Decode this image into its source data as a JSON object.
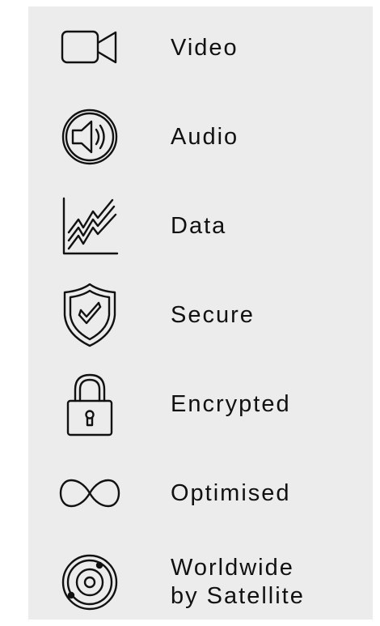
{
  "colors": {
    "panel_bg": "#ececec",
    "page_bg": "#ffffff",
    "ink": "#111111"
  },
  "features": [
    {
      "icon": "video-camera-icon",
      "label": "Video"
    },
    {
      "icon": "speaker-icon",
      "label": "Audio"
    },
    {
      "icon": "data-chart-icon",
      "label": "Data"
    },
    {
      "icon": "shield-check-icon",
      "label": "Secure"
    },
    {
      "icon": "padlock-icon",
      "label": "Encrypted"
    },
    {
      "icon": "infinity-icon",
      "label": "Optimised"
    },
    {
      "icon": "satellite-orbit-icon",
      "label_line1": "Worldwide",
      "label_line2": "by Satellite"
    }
  ]
}
